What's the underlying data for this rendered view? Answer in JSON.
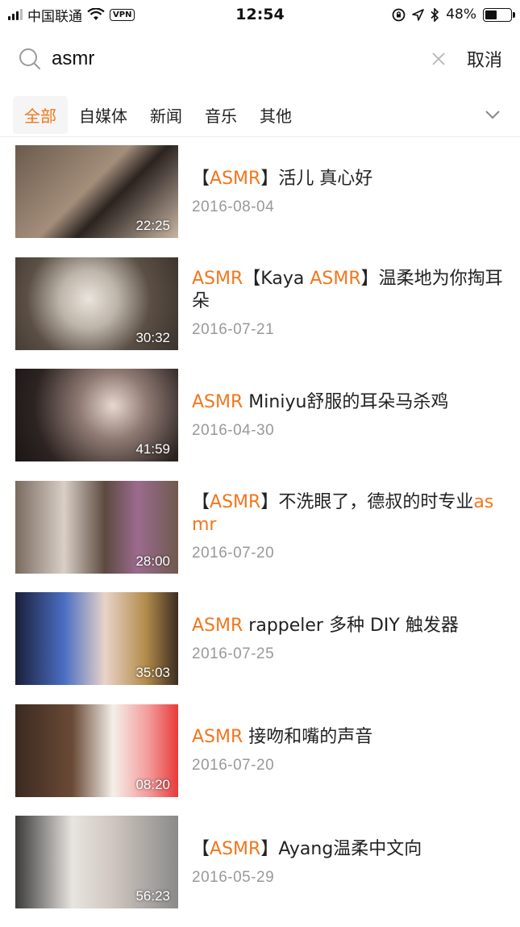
{
  "status_bar": {
    "carrier": "中国联通",
    "vpn": "VPN",
    "time": "12:54",
    "battery": "48%",
    "battery_level": 0.48
  },
  "search": {
    "query": "asmr",
    "cancel_label": "取消"
  },
  "tabs": [
    {
      "label": "全部",
      "active": true
    },
    {
      "label": "自媒体",
      "active": false
    },
    {
      "label": "新闻",
      "active": false
    },
    {
      "label": "音乐",
      "active": false
    },
    {
      "label": "其他",
      "active": false
    }
  ],
  "accent_color": "#f2761d",
  "results": [
    {
      "title_parts": [
        {
          "t": "【",
          "hl": false
        },
        {
          "t": "ASMR",
          "hl": true
        },
        {
          "t": "】活儿 真心好",
          "hl": false
        }
      ],
      "date": "2016-08-04",
      "duration": "22:25"
    },
    {
      "title_parts": [
        {
          "t": "ASMR",
          "hl": true
        },
        {
          "t": "【Kaya ",
          "hl": false
        },
        {
          "t": "ASMR",
          "hl": true
        },
        {
          "t": "】温柔地为你掏耳朵",
          "hl": false
        }
      ],
      "date": "2016-07-21",
      "duration": "30:32"
    },
    {
      "title_parts": [
        {
          "t": "ASMR",
          "hl": true
        },
        {
          "t": " Miniyu舒服的耳朵马杀鸡",
          "hl": false
        }
      ],
      "date": "2016-04-30",
      "duration": "41:59"
    },
    {
      "title_parts": [
        {
          "t": "【",
          "hl": false
        },
        {
          "t": "ASMR",
          "hl": true
        },
        {
          "t": "】不洗眼了，德叔的时专业",
          "hl": false
        },
        {
          "t": "asmr",
          "hl": true
        }
      ],
      "date": "2016-07-20",
      "duration": "28:00"
    },
    {
      "title_parts": [
        {
          "t": "ASMR",
          "hl": true
        },
        {
          "t": " rappeler 多种 DIY 触发器",
          "hl": false
        }
      ],
      "date": "2016-07-25",
      "duration": "35:03"
    },
    {
      "title_parts": [
        {
          "t": "ASMR",
          "hl": true
        },
        {
          "t": " 接吻和嘴的声音",
          "hl": false
        }
      ],
      "date": "2016-07-20",
      "duration": "08:20"
    },
    {
      "title_parts": [
        {
          "t": "【",
          "hl": false
        },
        {
          "t": "ASMR",
          "hl": true
        },
        {
          "t": "】Ayang温柔中文向",
          "hl": false
        }
      ],
      "date": "2016-05-29",
      "duration": "56:23"
    }
  ]
}
